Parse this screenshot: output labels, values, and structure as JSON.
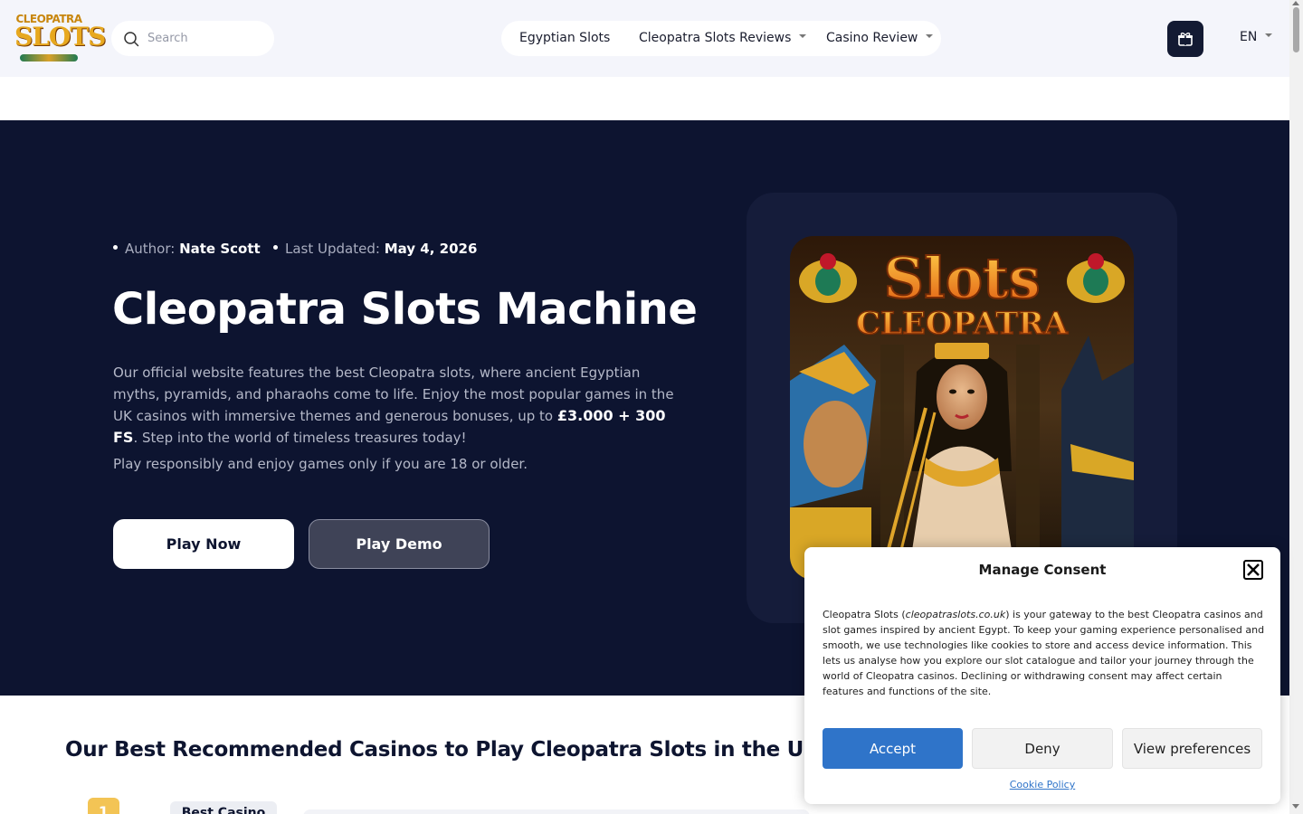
{
  "header": {
    "logo_top": "CLEOPATRA",
    "logo_main": "SLOTS",
    "search_placeholder": "Search",
    "nav": [
      {
        "label": "Egyptian Slots",
        "has_dropdown": false
      },
      {
        "label": "Cleopatra Slots Reviews",
        "has_dropdown": true
      },
      {
        "label": "Casino Review",
        "has_dropdown": true
      }
    ],
    "gift_icon": "gift-icon",
    "language": "EN"
  },
  "hero": {
    "author_label": "Author:",
    "author_name": "Nate Scott",
    "updated_label": "Last Updated:",
    "updated_date": "May 4, 2026",
    "title": "Cleopatra Slots Machine",
    "desc_1": "Our official website features the best Cleopatra slots, where ancient Egyptian myths, pyramids, and pharaohs come to life. Enjoy the most popular games in the UK casinos with immersive themes and generous bonuses, up to ",
    "desc_bonus": "£3.000 + 300 FS",
    "desc_2": ". Step into the world of timeless treasures today!",
    "note": "Play responsibly and enjoy games only if you are 18 or older.",
    "play_now": "Play Now",
    "play_demo": "Play Demo",
    "image_title_1": "Slots",
    "image_title_2": "CLEOPATRA"
  },
  "section": {
    "title": "Our Best Recommended Casinos to Play Cleopatra Slots in the UK",
    "rank": "1",
    "badge": "Best Casino"
  },
  "consent": {
    "title": "Manage Consent",
    "text_1": "Cleopatra Slots (",
    "text_domain": "cleopatraslots.co.uk",
    "text_2": ") is your gateway to the best Cleopatra casinos and slot games inspired by ancient Egypt. To keep your gaming experience personalised and smooth, we use technologies like cookies to store and access device information. This lets us analyse how you explore our slot catalogue and tailor your journey through the world of Cleopatra casinos. Declining or withdrawing consent may affect certain features and functions of the site.",
    "accept": "Accept",
    "deny": "Deny",
    "preferences": "View preferences",
    "policy": "Cookie Policy"
  },
  "colors": {
    "hero_bg": "#0d1430",
    "accent_blue": "#2f74c9",
    "header_bg": "#f4f5fb"
  }
}
